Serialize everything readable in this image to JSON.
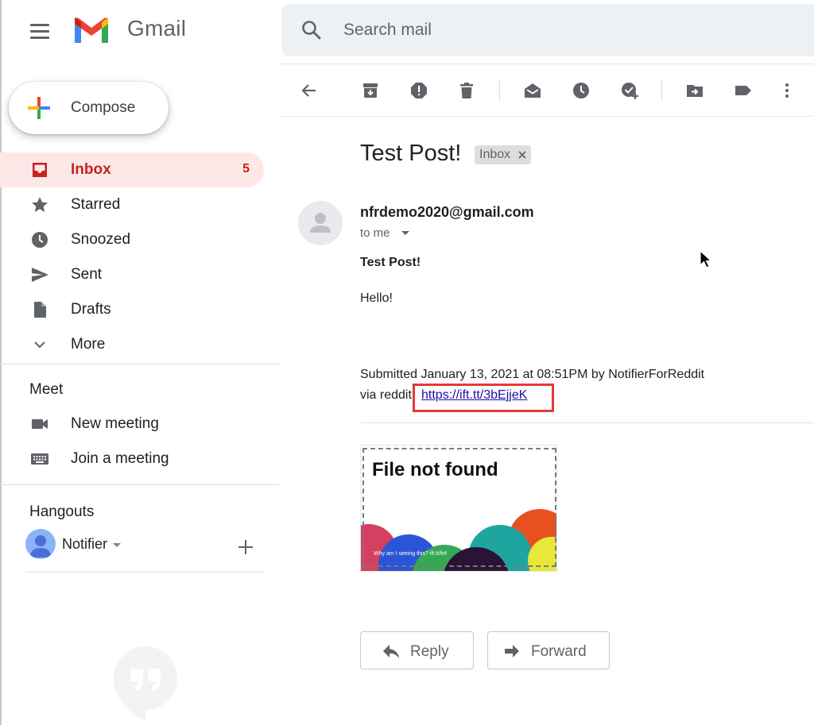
{
  "app": {
    "brand": "Gmail"
  },
  "search": {
    "placeholder": "Search mail"
  },
  "compose": {
    "label": "Compose"
  },
  "nav": {
    "items": [
      {
        "label": "Inbox",
        "count": "5",
        "icon": "inbox-icon"
      },
      {
        "label": "Starred",
        "icon": "star-icon"
      },
      {
        "label": "Snoozed",
        "icon": "clock-icon"
      },
      {
        "label": "Sent",
        "icon": "send-icon"
      },
      {
        "label": "Drafts",
        "icon": "draft-icon"
      },
      {
        "label": "More",
        "icon": "chevron-down-icon"
      }
    ]
  },
  "meet": {
    "title": "Meet",
    "items": [
      {
        "label": "New meeting",
        "icon": "video-icon"
      },
      {
        "label": "Join a meeting",
        "icon": "keyboard-icon"
      }
    ]
  },
  "hangouts": {
    "title": "Hangouts",
    "user": "Notifier"
  },
  "email": {
    "subject": "Test Post!",
    "label": "Inbox",
    "sender": "nfrdemo2020@gmail.com",
    "to": "to me",
    "body_title": "Test Post!",
    "body_text": "Hello!",
    "submitted": "Submitted January 13, 2021 at 08:51PM by NotifierForReddit",
    "via": "via reddit",
    "link": "https://ift.tt/3bEjjeK",
    "image": {
      "title": "File not found",
      "caption": "Why am I seeing this? ift.tt/fnf"
    }
  },
  "actions": {
    "reply": "Reply",
    "forward": "Forward"
  },
  "colors": {
    "accent": "#c5221f",
    "active_bg": "#fce8e6",
    "highlight_box": "#e53935",
    "link": "#1a0dab"
  }
}
